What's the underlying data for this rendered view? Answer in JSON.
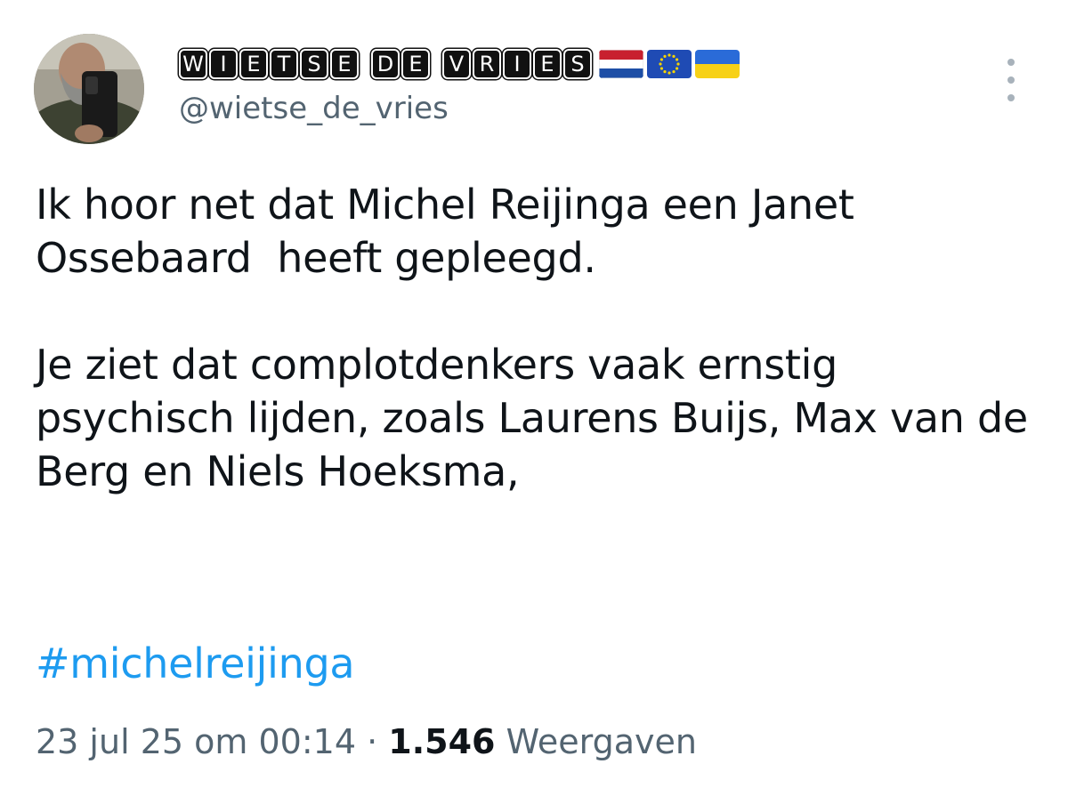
{
  "author": {
    "display_name": "WIETSE DE VRIES",
    "name_tiles": [
      "W",
      "I",
      "E",
      "T",
      "S",
      "E",
      " ",
      "D",
      "E",
      " ",
      "V",
      "R",
      "I",
      "E",
      "S"
    ],
    "flags": [
      "netherlands-flag",
      "eu-flag",
      "ukraine-flag"
    ],
    "handle": "@wietse_de_vries",
    "avatar": "profile-photo"
  },
  "tweet": {
    "paragraph_1": "Ik hoor net dat Michel Reijinga een Janet Ossebaard  heeft gepleegd.",
    "paragraph_2": "Je ziet dat complotdenkers vaak ernstig psychisch lijden, zoals Laurens Buijs, Max van de Berg en Niels Hoeksma,",
    "hashtag": "#michelreijinga"
  },
  "meta": {
    "timestamp": "23 jul 25 om 00:14",
    "separator": "·",
    "views_count": "1.546",
    "views_label": "Weergaven"
  },
  "icons": {
    "more": "more-vertical-icon"
  },
  "colors": {
    "text": "#0f1419",
    "secondary": "#536471",
    "link": "#1d9bf0"
  }
}
